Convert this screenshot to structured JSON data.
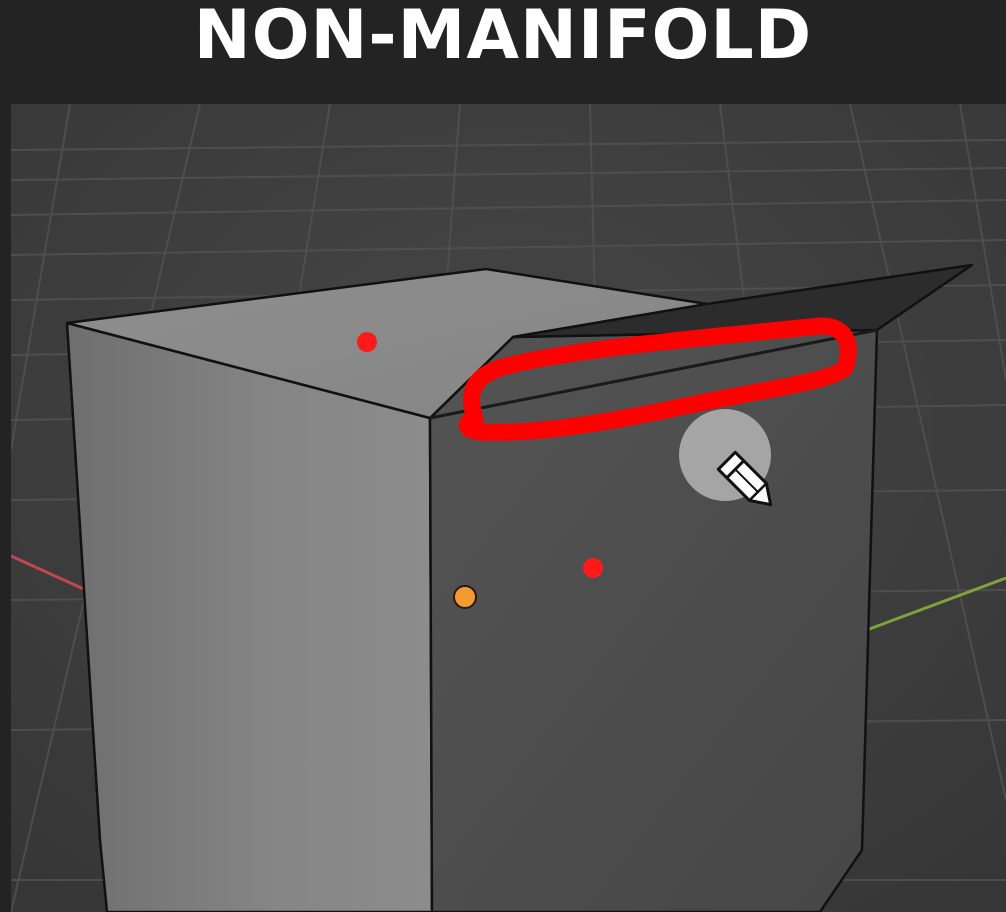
{
  "title": "NON-MANIFOLD",
  "viewport": {
    "name": "3d-viewport",
    "grid_floor": true,
    "axes": {
      "x_axis_color": "#c0484e",
      "y_axis_color": "#7fa33a"
    },
    "object": {
      "type": "cube",
      "face_colors": {
        "top": "#8a8a8a",
        "left": "#7a7a7a",
        "right": "#4d4d4d",
        "flap": "#2a2a2a"
      }
    },
    "annotation": {
      "shape": "freehand-loop",
      "color": "#ff0000"
    },
    "markers": {
      "red_dot_color": "#ff1a1a",
      "origin_color": "#f39a33"
    },
    "cursor": {
      "icon": "pencil-cursor-icon"
    }
  }
}
